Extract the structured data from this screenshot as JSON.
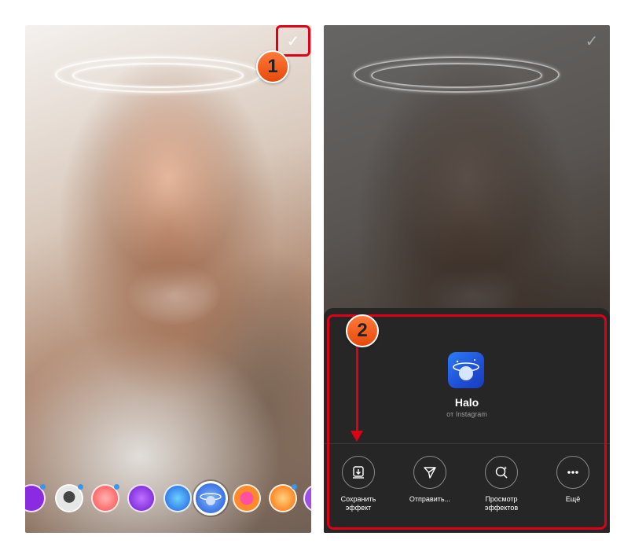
{
  "left_screen": {
    "confirm_icon": "check-icon",
    "effects": [
      {
        "icon": "effect-thumb",
        "color": "#8a2be2"
      },
      {
        "icon": "effect-thumb",
        "color": "#d9d9d9"
      },
      {
        "icon": "effect-thumb",
        "color": "#ff5a5a"
      },
      {
        "icon": "effect-thumb",
        "color": "#7a2ae0"
      },
      {
        "icon": "effect-thumb",
        "color": "#2c6df0"
      },
      {
        "icon": "effect-thumb-halo",
        "color": "#2f80f5",
        "selected": true
      },
      {
        "icon": "effect-thumb",
        "color": "#ff7a2a"
      },
      {
        "icon": "effect-thumb",
        "color": "#ff8a00"
      },
      {
        "icon": "effect-thumb",
        "color": "#a050e0"
      }
    ]
  },
  "right_screen": {
    "effect_name": "Halo",
    "effect_author": "от Instagram",
    "actions": [
      {
        "label_line1": "Сохранить",
        "label_line2": "эффект",
        "icon": "save-effect-icon"
      },
      {
        "label_line1": "Отправить...",
        "label_line2": "",
        "icon": "send-icon"
      },
      {
        "label_line1": "Просмотр",
        "label_line2": "эффектов",
        "icon": "browse-effects-icon"
      },
      {
        "label_line1": "Ещё",
        "label_line2": "",
        "icon": "more-icon"
      }
    ]
  },
  "annotations": {
    "marker_1": "1",
    "marker_2": "2",
    "highlight_color": "#e00016"
  }
}
